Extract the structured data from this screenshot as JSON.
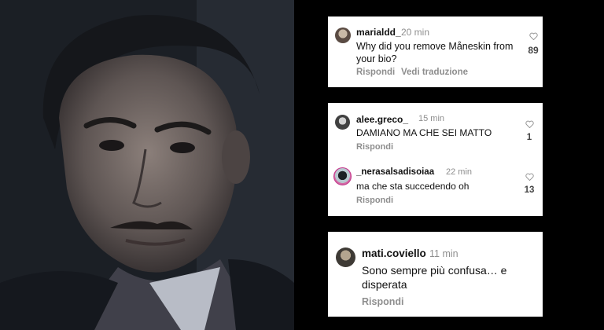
{
  "colors": {
    "background": "#000000",
    "card": "#ffffff",
    "muted": "#8e8e8e",
    "text": "#111111"
  },
  "photo": {
    "icon": "portrait-photo"
  },
  "comments": [
    {
      "username": "marialdd_",
      "time": "20 min",
      "text": "Why did you remove Måneskin from your bio?",
      "likes": "89",
      "reply": "Rispondi",
      "translate": "Vedi traduzione"
    },
    {
      "username": "alee.greco_",
      "time": "15 min",
      "text": "DAMIANO MA CHE SEI MATTO",
      "likes": "1",
      "reply": "Rispondi"
    },
    {
      "username": "_nerasalsadisoiaa",
      "time": "22 min",
      "text": "ma che sta succedendo oh",
      "likes": "13",
      "reply": "Rispondi"
    },
    {
      "username": "mati.coviello",
      "time": "11 min",
      "text": "Sono sempre più confusa… e disperata",
      "reply": "Rispondi"
    }
  ]
}
